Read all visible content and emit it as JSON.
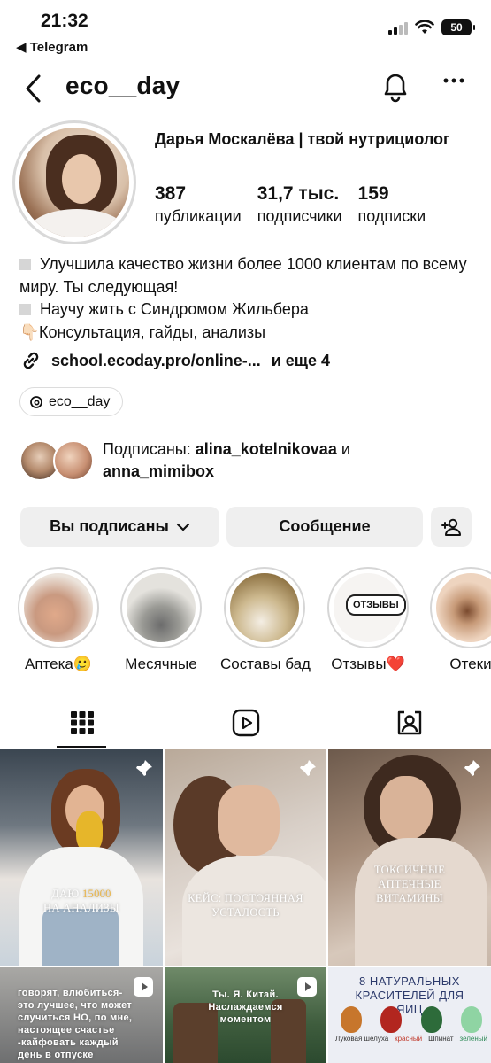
{
  "status_bar": {
    "time": "21:32",
    "back_app": "◀ Telegram",
    "battery": "50",
    "icons": [
      "signal-icon",
      "wifi-icon",
      "battery-icon"
    ]
  },
  "header": {
    "username": "eco__day",
    "icons": [
      "back-chevron-icon",
      "bell-icon",
      "more-icon"
    ]
  },
  "profile": {
    "full_name": "Дарья Москалёва | твой нутрициолог",
    "stats": [
      {
        "value": "387",
        "label": "публикации"
      },
      {
        "value": "31,7 тыс.",
        "label": "подписчики"
      },
      {
        "value": "159",
        "label": "подписки"
      }
    ],
    "bio": {
      "line1": "Улучшила качество жизни более 1000 клиентам по всему миру. Ты следующая!",
      "line2": "Научу жить с Синдромом Жильбера",
      "hand_emoji": "👇🏻",
      "line3": "Консультация, гайды, анализы"
    },
    "link": {
      "url": "school.ecoday.pro/online-...",
      "more": "и еще 4"
    },
    "threads_handle": "eco__day",
    "followed_by": {
      "prefix": "Подписаны: ",
      "user1": "alina_kotelnikovaa",
      "conj": " и",
      "user2": "anna_mimibox"
    }
  },
  "buttons": {
    "subscribed": "Вы подписаны",
    "message": "Сообщение"
  },
  "highlights": [
    {
      "label": "Аптека🥲"
    },
    {
      "label": "Месячные"
    },
    {
      "label": "Составы бад"
    },
    {
      "label": "Отзывы❤️",
      "inner_text": "ОТЗЫВЫ"
    },
    {
      "label": "Отеки"
    }
  ],
  "tabs": [
    {
      "name": "grid",
      "icon": "grid-icon",
      "active": true
    },
    {
      "name": "reels",
      "icon": "reels-icon",
      "active": false
    },
    {
      "name": "tagged",
      "icon": "tagged-icon",
      "active": false
    }
  ],
  "posts": [
    {
      "caption_a": "ДАЮ ",
      "caption_accent": "15000",
      "caption_b": "НА АНАЛИЗЫ",
      "pinned": true
    },
    {
      "caption": "КЕЙС: ПОСТОЯННАЯ УСТАЛОСТЬ",
      "pinned": true
    },
    {
      "caption": "ТОКСИЧНЫЕ АПТЕЧНЫЕ ВИТАМИНЫ",
      "pinned": true
    },
    {
      "caption": "говорят, влюбиться-это лучшее, что может случиться НО, по мне, настоящее счастье -кайфовать каждый день в отпуске",
      "reel": true
    },
    {
      "caption": "Ты. Я. Китай. Наслаждаемся моментом",
      "reel": true
    },
    {
      "caption": "8 НАТУРАЛЬНЫХ КРАСИТЕЛЕЙ ДЛЯ ЯИЦ",
      "egg_labels": [
        "Луковая шелуха",
        "красный",
        "Шпинат",
        "зеленый"
      ]
    }
  ],
  "colors": {
    "text": "#111111",
    "button_bg": "#efefef",
    "accent_gold": "#e9b447"
  }
}
